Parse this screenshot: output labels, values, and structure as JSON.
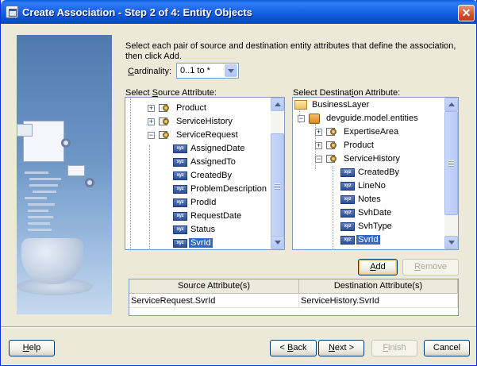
{
  "window": {
    "title": "Create Association - Step 2 of 4: Entity Objects",
    "close_glyph": "✕"
  },
  "instructions": "Select each pair of source and destination entity attributes that define the association, then click Add.",
  "cardinality": {
    "label_before": "",
    "label_accel": "C",
    "label_after": "ardinality:",
    "value": "0..1 to *"
  },
  "source": {
    "label_pre": "Select ",
    "label_accel": "S",
    "label_post": "ource Attribute:",
    "rows": [
      {
        "label": "Product",
        "kind": "entity",
        "expander": "+"
      },
      {
        "label": "ServiceHistory",
        "kind": "entity",
        "expander": "+"
      },
      {
        "label": "ServiceRequest",
        "kind": "entity",
        "expander": "−"
      },
      {
        "label": "AssignedDate",
        "kind": "attr"
      },
      {
        "label": "AssignedTo",
        "kind": "attr"
      },
      {
        "label": "CreatedBy",
        "kind": "attr"
      },
      {
        "label": "ProblemDescription",
        "kind": "attr"
      },
      {
        "label": "ProdId",
        "kind": "attr"
      },
      {
        "label": "RequestDate",
        "kind": "attr"
      },
      {
        "label": "Status",
        "kind": "attr"
      },
      {
        "label": "SvrId",
        "kind": "attr",
        "selected": true
      }
    ]
  },
  "destination": {
    "label_pre": "Select Destinat",
    "label_accel": "i",
    "label_post": "on Attribute:",
    "rows": [
      {
        "label": "BusinessLayer",
        "kind": "folder"
      },
      {
        "label": "devguide.model.entities",
        "kind": "package",
        "expander": "−"
      },
      {
        "label": "ExpertiseArea",
        "kind": "entity",
        "expander": "+"
      },
      {
        "label": "Product",
        "kind": "entity",
        "expander": "+"
      },
      {
        "label": "ServiceHistory",
        "kind": "entity",
        "expander": "−"
      },
      {
        "label": "CreatedBy",
        "kind": "attr"
      },
      {
        "label": "LineNo",
        "kind": "attr"
      },
      {
        "label": "Notes",
        "kind": "attr"
      },
      {
        "label": "SvhDate",
        "kind": "attr"
      },
      {
        "label": "SvhType",
        "kind": "attr"
      },
      {
        "label": "SvrId",
        "kind": "attr",
        "selected": true
      }
    ]
  },
  "attr_icon_text": "xyz",
  "buttons": {
    "add": {
      "accel": "A",
      "rest": "dd"
    },
    "remove": {
      "accel": "R",
      "rest": "emove"
    },
    "help": {
      "accel": "H",
      "rest": "elp"
    },
    "back": {
      "pre": "< ",
      "accel": "B",
      "rest": "ack"
    },
    "next": {
      "accel": "N",
      "rest": "ext >"
    },
    "finish": {
      "accel": "F",
      "rest": "inish"
    },
    "cancel": {
      "label": "Cancel"
    }
  },
  "grid": {
    "headers": [
      "Source Attribute(s)",
      "Destination Attribute(s)"
    ],
    "rows": [
      [
        "ServiceRequest.SvrId",
        "ServiceHistory.SvrId"
      ]
    ]
  }
}
